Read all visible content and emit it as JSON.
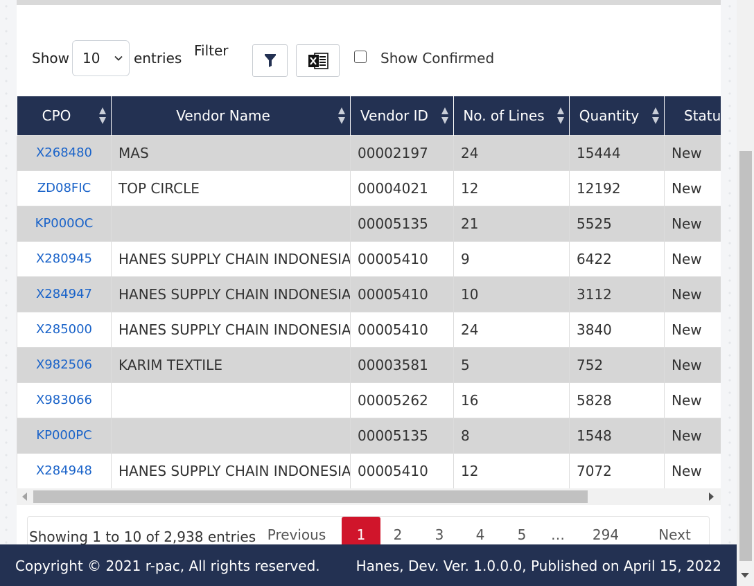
{
  "controls": {
    "show_label": "Show",
    "entries_value": "10",
    "entries_label": "entries",
    "filter_label": "Filter",
    "show_confirmed_label": "Show Confirmed",
    "show_confirmed_checked": false
  },
  "table": {
    "columns": [
      "CPO",
      "Vendor Name",
      "Vendor ID",
      "No. of Lines",
      "Quantity",
      "Status"
    ],
    "rows": [
      {
        "cpo": "X268480",
        "vendor_name": "MAS",
        "vendor_id": "00002197",
        "lines": "24",
        "quantity": "15444",
        "status": "New"
      },
      {
        "cpo": "ZD08FIC",
        "vendor_name": "TOP CIRCLE",
        "vendor_id": "00004021",
        "lines": "12",
        "quantity": "12192",
        "status": "New"
      },
      {
        "cpo": "KP000OC",
        "vendor_name": "",
        "vendor_id": "00005135",
        "lines": "21",
        "quantity": "5525",
        "status": "New"
      },
      {
        "cpo": "X280945",
        "vendor_name": "HANES SUPPLY CHAIN INDONESIA",
        "vendor_id": "00005410",
        "lines": "9",
        "quantity": "6422",
        "status": "New"
      },
      {
        "cpo": "X284947",
        "vendor_name": "HANES SUPPLY CHAIN INDONESIA",
        "vendor_id": "00005410",
        "lines": "10",
        "quantity": "3112",
        "status": "New"
      },
      {
        "cpo": "X285000",
        "vendor_name": "HANES SUPPLY CHAIN INDONESIA",
        "vendor_id": "00005410",
        "lines": "24",
        "quantity": "3840",
        "status": "New"
      },
      {
        "cpo": "X982506",
        "vendor_name": "KARIM TEXTILE",
        "vendor_id": "00003581",
        "lines": "5",
        "quantity": "752",
        "status": "New"
      },
      {
        "cpo": "X983066",
        "vendor_name": "",
        "vendor_id": "00005262",
        "lines": "16",
        "quantity": "5828",
        "status": "New"
      },
      {
        "cpo": "KP000PC",
        "vendor_name": "",
        "vendor_id": "00005135",
        "lines": "8",
        "quantity": "1548",
        "status": "New"
      },
      {
        "cpo": "X284948",
        "vendor_name": "HANES SUPPLY CHAIN INDONESIA",
        "vendor_id": "00005410",
        "lines": "12",
        "quantity": "7072",
        "status": "New"
      }
    ]
  },
  "pagination": {
    "info": "Showing 1 to 10 of 2,938 entries",
    "previous": "Previous",
    "pages": [
      "1",
      "2",
      "3",
      "4",
      "5",
      "…",
      "294"
    ],
    "active_page": "1",
    "next": "Next"
  },
  "footer": {
    "copyright": "Copyright © 2021 r-pac, All rights reserved.",
    "version": "Hanes, Dev. Ver. 1.0.0.0, Published on April 15, 2022"
  },
  "icons": {
    "filter": "funnel-icon",
    "export": "excel-icon",
    "sort": "sort-arrows-icon"
  },
  "colors": {
    "header_bg": "#233152",
    "link": "#1a63c9",
    "active_page": "#d0152b",
    "row_alt": "#d6d6d6"
  }
}
